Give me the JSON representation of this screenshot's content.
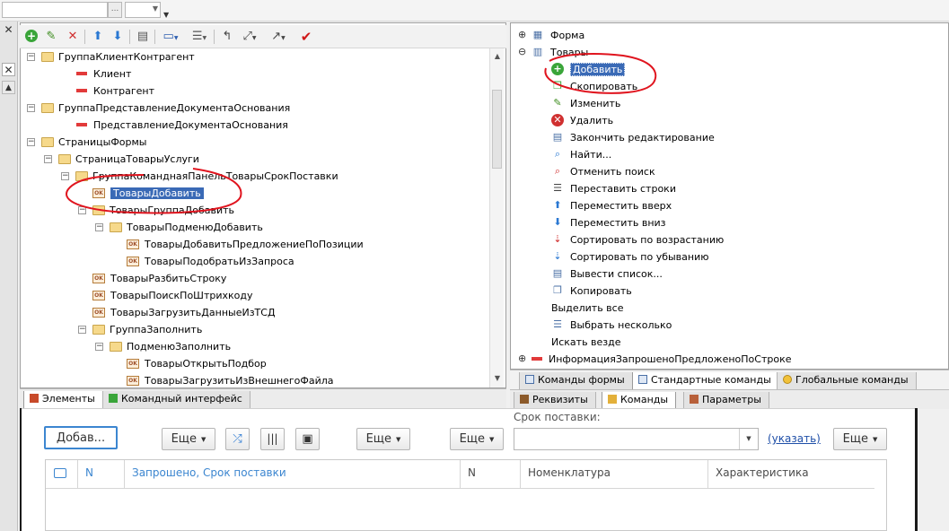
{
  "left_panel": {
    "tree": [
      {
        "label": "ГруппаКлиентКонтрагент",
        "depth": 0,
        "icon": "folder-icon",
        "expand": "−"
      },
      {
        "label": "Клиент",
        "depth": 1,
        "icon": "field-icon"
      },
      {
        "label": "Контрагент",
        "depth": 1,
        "icon": "field-icon"
      },
      {
        "label": "ГруппаПредставлениеДокументаОснования",
        "depth": 0,
        "icon": "folder-icon",
        "expand": "−"
      },
      {
        "label": "ПредставлениеДокументаОснования",
        "depth": 1,
        "icon": "field-icon"
      },
      {
        "label": "СтраницыФормы",
        "depth": 0,
        "icon": "folder-icon",
        "expand": "−"
      },
      {
        "label": "СтраницаТоварыУслуги",
        "depth": 1,
        "icon": "folder-icon",
        "expand": "−"
      },
      {
        "label": "ГруппаКоманднаяПанельТоварыСрокПоставки",
        "depth": 2,
        "icon": "folder-icon",
        "expand": "−"
      },
      {
        "label": "ТоварыДобавить",
        "depth": 3,
        "icon": "button-icon",
        "selected": true
      },
      {
        "label": "ТоварыГруппаДобавить",
        "depth": 3,
        "icon": "folder-icon",
        "expand": "−"
      },
      {
        "label": "ТоварыПодменюДобавить",
        "depth": 4,
        "icon": "folder-icon",
        "expand": "−"
      },
      {
        "label": "ТоварыДобавитьПредложениеПоПозиции",
        "depth": 5,
        "icon": "button-icon"
      },
      {
        "label": "ТоварыПодобратьИзЗапроса",
        "depth": 5,
        "icon": "button-icon"
      },
      {
        "label": "ТоварыРазбитьСтроку",
        "depth": 3,
        "icon": "button-icon"
      },
      {
        "label": "ТоварыПоискПоШтрихкоду",
        "depth": 3,
        "icon": "button-icon"
      },
      {
        "label": "ТоварыЗагрузитьДанныеИзТСД",
        "depth": 3,
        "icon": "button-icon"
      },
      {
        "label": "ГруппаЗаполнить",
        "depth": 3,
        "icon": "folder-icon",
        "expand": "−"
      },
      {
        "label": "ПодменюЗаполнить",
        "depth": 4,
        "icon": "folder-icon",
        "expand": "−"
      },
      {
        "label": "ТоварыОткрытьПодбор",
        "depth": 5,
        "icon": "button-icon"
      },
      {
        "label": "ТоварыЗагрузитьИзВнешнегоФайла",
        "depth": 5,
        "icon": "button-icon"
      }
    ],
    "bottom_tabs": [
      {
        "label": "Элементы",
        "active": true
      },
      {
        "label": "Командный интерфейс",
        "active": false
      }
    ]
  },
  "right_panel": {
    "tree": [
      {
        "label": "Форма",
        "depth": 0,
        "icon": "form-icon",
        "expand": "+"
      },
      {
        "label": "Товары",
        "depth": 0,
        "icon": "table-icon",
        "expand": "−"
      },
      {
        "label": "Добавить",
        "depth": 1,
        "icon": "add-icon",
        "selected": true
      },
      {
        "label": "Скопировать",
        "depth": 1,
        "icon": "copy-icon"
      },
      {
        "label": "Изменить",
        "depth": 1,
        "icon": "edit-icon"
      },
      {
        "label": "Удалить",
        "depth": 1,
        "icon": "delete-icon"
      },
      {
        "label": "Закончить редактирование",
        "depth": 1,
        "icon": "end-edit-icon"
      },
      {
        "label": "Найти...",
        "depth": 1,
        "icon": "find-icon"
      },
      {
        "label": "Отменить поиск",
        "depth": 1,
        "icon": "cancel-search-icon"
      },
      {
        "label": "Переставить строки",
        "depth": 1,
        "icon": "reorder-icon"
      },
      {
        "label": "Переместить вверх",
        "depth": 1,
        "icon": "arrow-up-icon"
      },
      {
        "label": "Переместить вниз",
        "depth": 1,
        "icon": "arrow-down-icon"
      },
      {
        "label": "Сортировать по возрастанию",
        "depth": 1,
        "icon": "sort-asc-icon"
      },
      {
        "label": "Сортировать по убыванию",
        "depth": 1,
        "icon": "sort-desc-icon"
      },
      {
        "label": "Вывести список...",
        "depth": 1,
        "icon": "output-list-icon"
      },
      {
        "label": "Копировать",
        "depth": 1,
        "icon": "copy-clipboard-icon"
      },
      {
        "label": "Выделить все",
        "depth": 1,
        "icon": ""
      },
      {
        "label": "Выбрать несколько",
        "depth": 1,
        "icon": "select-multiple-icon"
      },
      {
        "label": "Искать везде",
        "depth": 1,
        "icon": ""
      },
      {
        "label": "ИнформацияЗапрошеноПредложеноПоСтроке",
        "depth": 0,
        "icon": "field-icon",
        "expand": "+"
      }
    ],
    "tabs_top": [
      {
        "label": "Команды формы",
        "active": false
      },
      {
        "label": "Стандартные команды",
        "active": true
      },
      {
        "label": "Глобальные команды",
        "active": false
      }
    ],
    "tabs_bottom": [
      {
        "label": "Реквизиты",
        "active": false
      },
      {
        "label": "Команды",
        "active": true
      },
      {
        "label": "Параметры",
        "active": false
      }
    ]
  },
  "form_preview": {
    "add_button": "Добав...",
    "more_label": "Еще",
    "srok_label": "Срок поставки:",
    "ukazat_link": "(указать)",
    "grid_columns": [
      "N",
      "Запрошено, Срок поставки",
      "N",
      "Номенклатура",
      "Характеристика"
    ]
  },
  "colors": {
    "selection": "#3a6ab6",
    "annotation": "#e0141e",
    "link": "#1f4fa8"
  }
}
